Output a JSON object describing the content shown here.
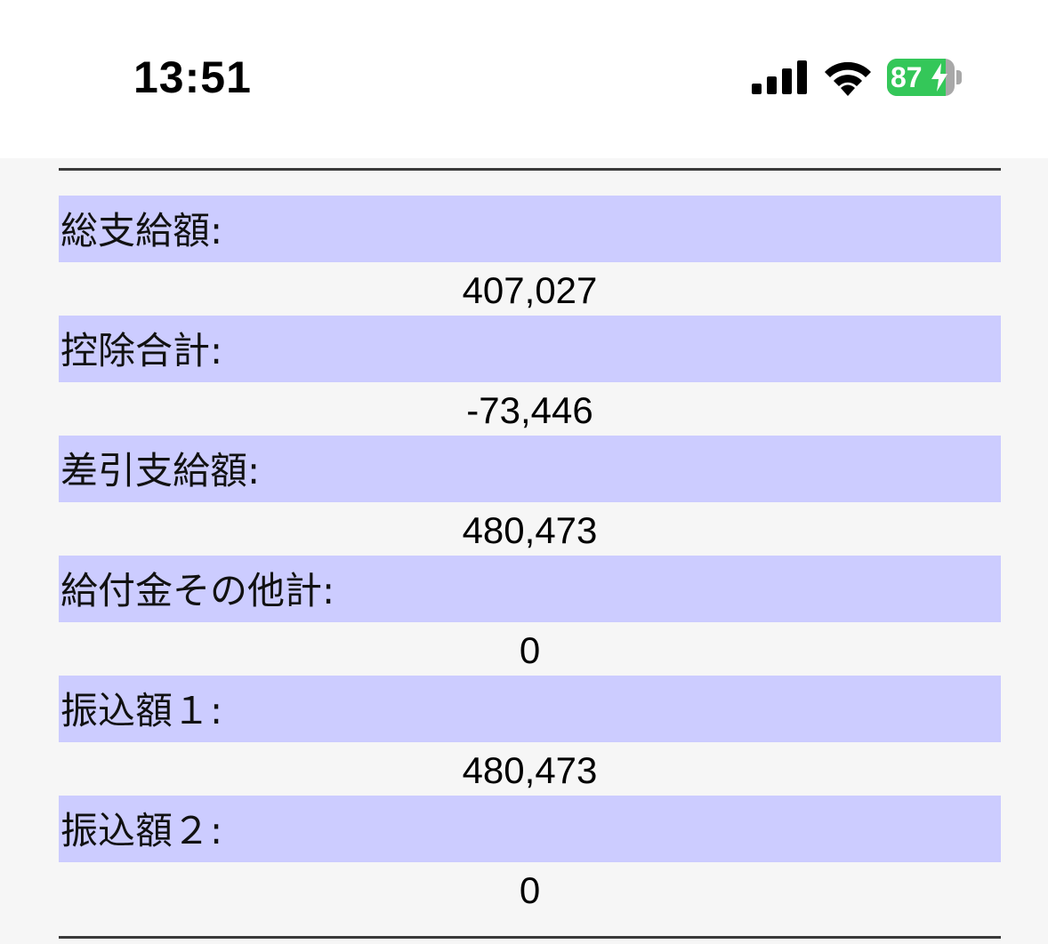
{
  "status_bar": {
    "time": "13:51",
    "battery_percent": "87",
    "battery_level": 0.87,
    "signal_icon": "cellular-signal-icon",
    "wifi_icon": "wifi-icon",
    "charging_icon": "charging-bolt-icon",
    "battery_color": "#34c759"
  },
  "payslip": {
    "rows": [
      {
        "label": "総支給額:",
        "value": "407,027"
      },
      {
        "label": "控除合計:",
        "value": "-73,446"
      },
      {
        "label": "差引支給額:",
        "value": "480,473"
      },
      {
        "label": "給付金その他計:",
        "value": "0"
      },
      {
        "label": "振込額１:",
        "value": "480,473"
      },
      {
        "label": "振込額２:",
        "value": "0"
      }
    ],
    "label_bg_color": "#ccccff"
  }
}
